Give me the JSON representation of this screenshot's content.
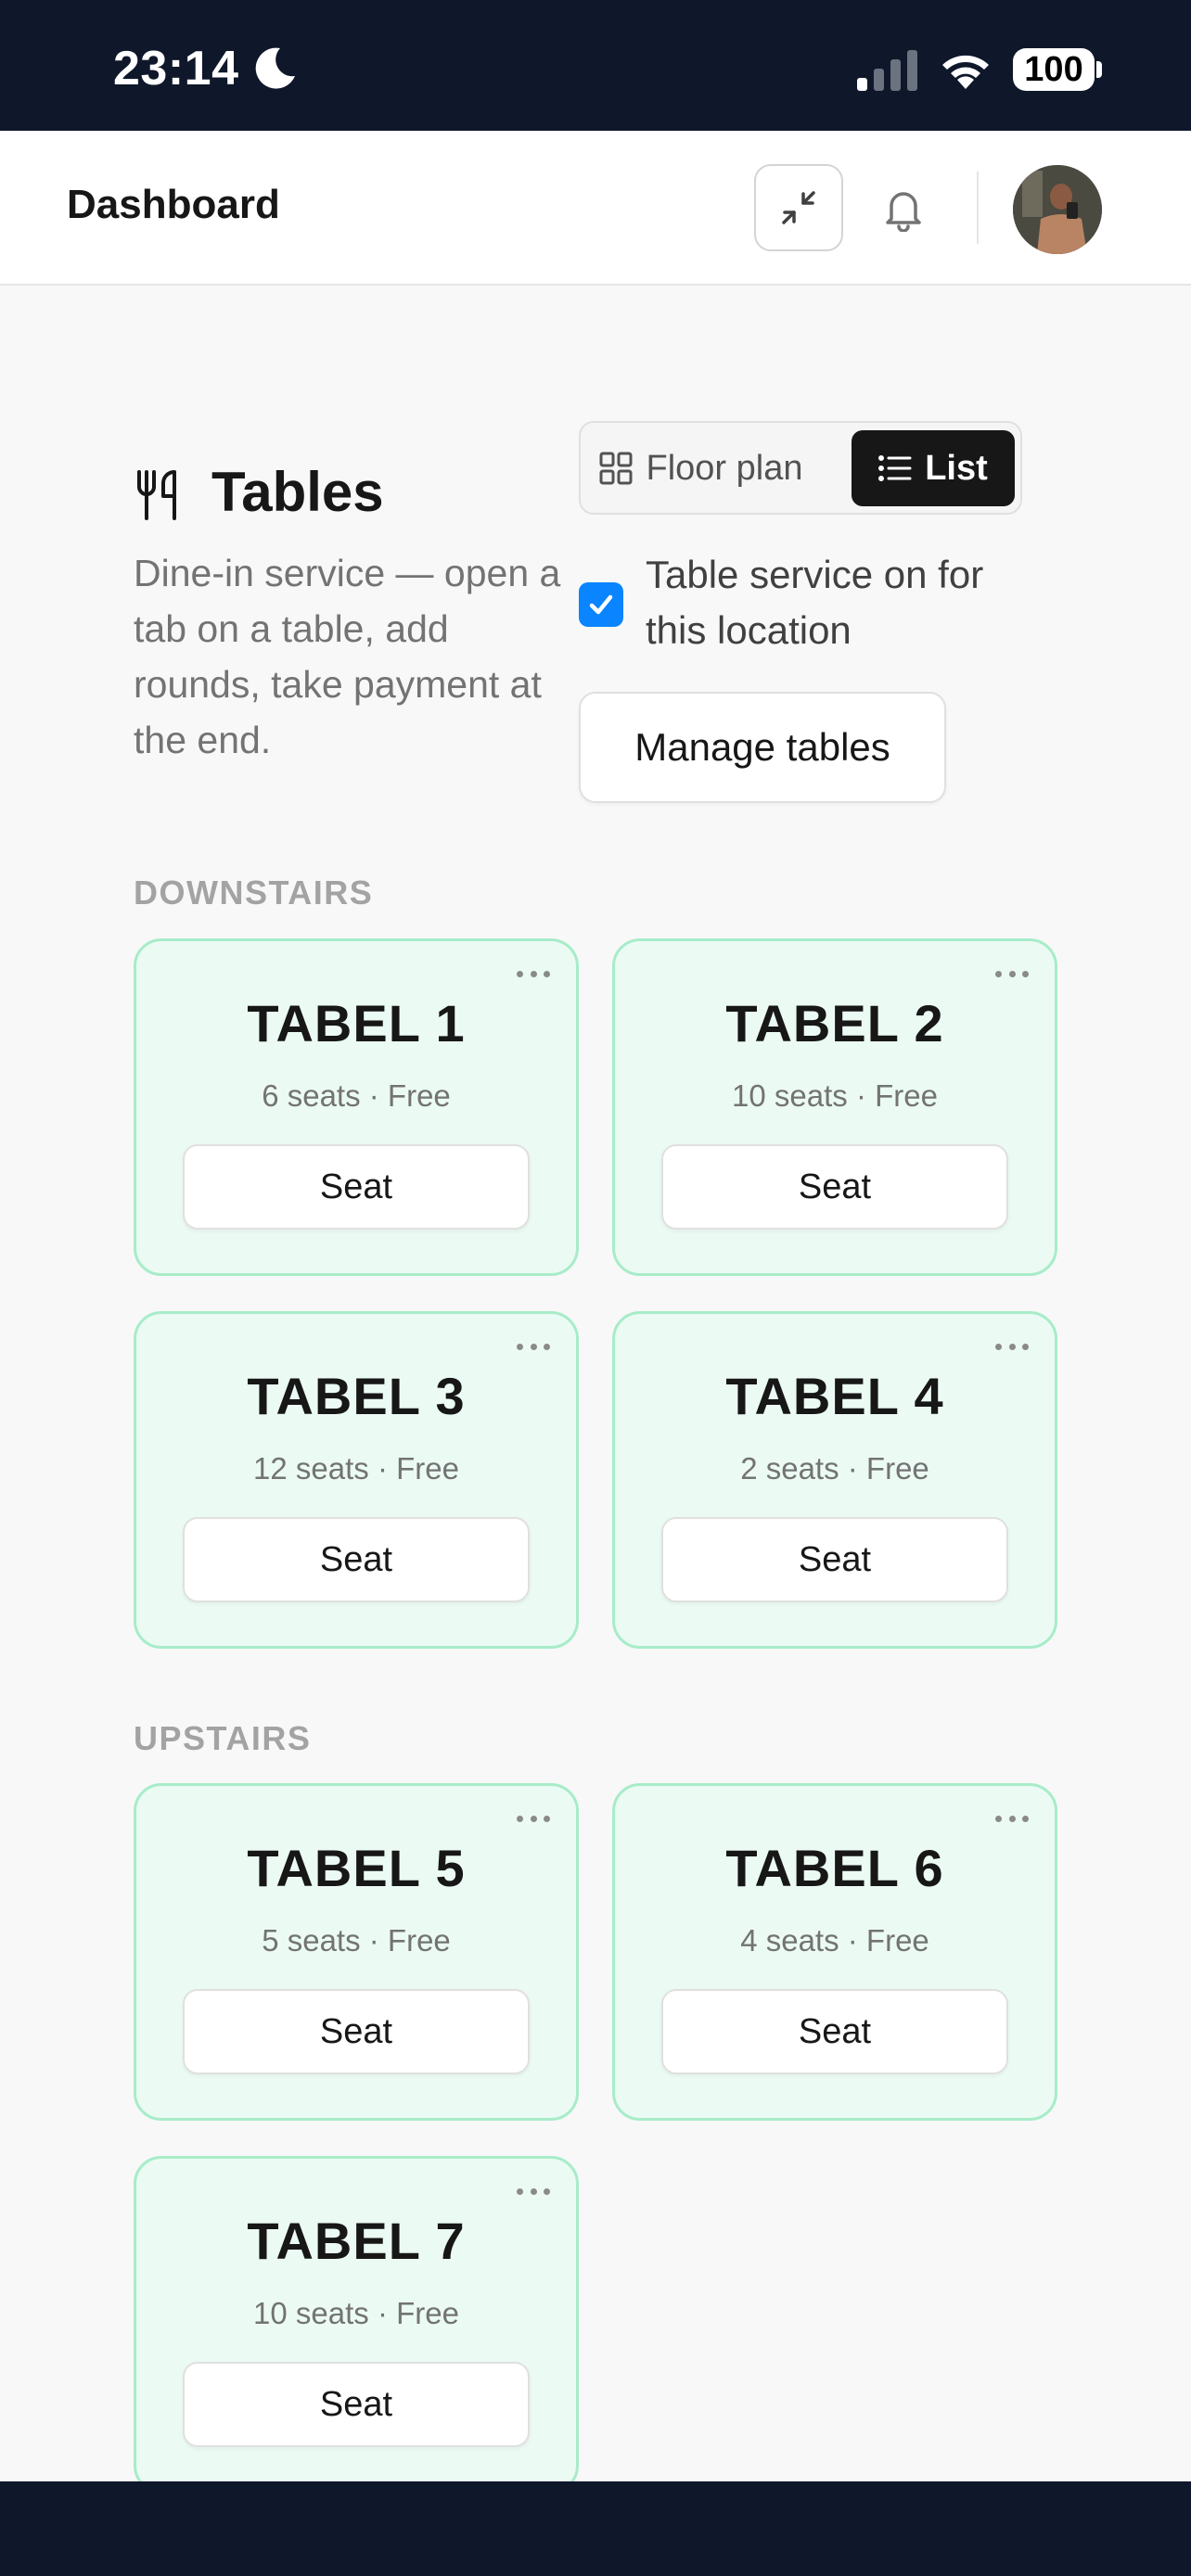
{
  "status_bar": {
    "time": "23:14",
    "battery": "100",
    "icons": [
      "moon-icon",
      "signal-icon",
      "wifi-icon",
      "battery-icon"
    ]
  },
  "header": {
    "title": "Dashboard",
    "icons": [
      "collapse-icon",
      "bell-icon",
      "avatar"
    ]
  },
  "tables_section": {
    "title": "Tables",
    "icon": "utensils-icon",
    "description": "Dine-in service — open a tab on a table, add rounds, take payment at the end.",
    "view_toggle": {
      "floor_plan": "Floor plan",
      "list": "List",
      "selected": "List"
    },
    "service_toggle": {
      "label": "Table service on for this location",
      "checked": true
    },
    "manage_button": "Manage tables"
  },
  "groups": [
    {
      "label": "DOWNSTAIRS",
      "tables": [
        {
          "name": "TABEL 1",
          "meta": "6 seats · Free",
          "action": "Seat"
        },
        {
          "name": "TABEL 2",
          "meta": "10 seats · Free",
          "action": "Seat"
        },
        {
          "name": "TABEL 3",
          "meta": "12 seats · Free",
          "action": "Seat"
        },
        {
          "name": "TABEL 4",
          "meta": "2 seats · Free",
          "action": "Seat"
        }
      ]
    },
    {
      "label": "UPSTAIRS",
      "tables": [
        {
          "name": "TABEL 5",
          "meta": "5 seats · Free",
          "action": "Seat"
        },
        {
          "name": "TABEL 6",
          "meta": "4 seats · Free",
          "action": "Seat"
        },
        {
          "name": "TABEL 7",
          "meta": "10 seats · Free",
          "action": "Seat"
        }
      ]
    }
  ],
  "colors": {
    "status_bar": "#0f172a",
    "card_bg": "#ebfbf3",
    "card_border": "#a7ecc9",
    "checkbox": "#0a84ff",
    "toggle_active": "#171717"
  }
}
